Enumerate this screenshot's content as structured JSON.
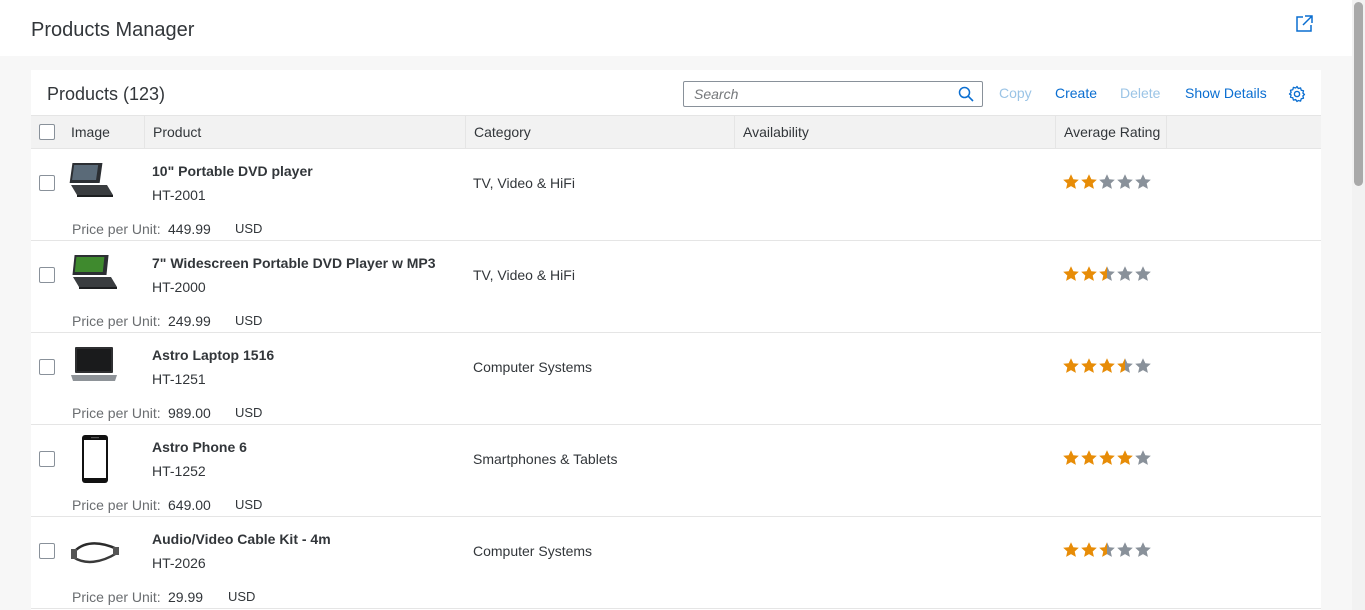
{
  "app": {
    "title": "Products Manager"
  },
  "panel": {
    "title": "Products (123)"
  },
  "search": {
    "placeholder": "Search"
  },
  "toolbar": {
    "copy": "Copy",
    "create": "Create",
    "delete": "Delete",
    "show_details": "Show Details"
  },
  "columns": {
    "image": "Image",
    "product": "Product",
    "category": "Category",
    "availability": "Availability",
    "rating": "Average Rating"
  },
  "price_label": "Price per Unit:",
  "products": [
    {
      "name": "10\" Portable DVD player",
      "id": "HT-2001",
      "category": "TV, Video & HiFi",
      "price": "449.99",
      "currency": "USD",
      "rating": 2
    },
    {
      "name": "7\" Widescreen Portable DVD Player w MP3",
      "id": "HT-2000",
      "category": "TV, Video & HiFi",
      "price": "249.99",
      "currency": "USD",
      "rating": 2.5
    },
    {
      "name": "Astro Laptop 1516",
      "id": "HT-1251",
      "category": "Computer Systems",
      "price": "989.00",
      "currency": "USD",
      "rating": 3.5
    },
    {
      "name": "Astro Phone 6",
      "id": "HT-1252",
      "category": "Smartphones & Tablets",
      "price": "649.00",
      "currency": "USD",
      "rating": 4
    },
    {
      "name": "Audio/Video Cable Kit - 4m",
      "id": "HT-2026",
      "category": "Computer Systems",
      "price": "29.99",
      "currency": "USD",
      "rating": 2.5
    }
  ],
  "colors": {
    "star_filled": "#e78c07",
    "star_empty": "#89919a",
    "link": "#0a6ed1",
    "link_disabled": "#9bc4e6"
  }
}
